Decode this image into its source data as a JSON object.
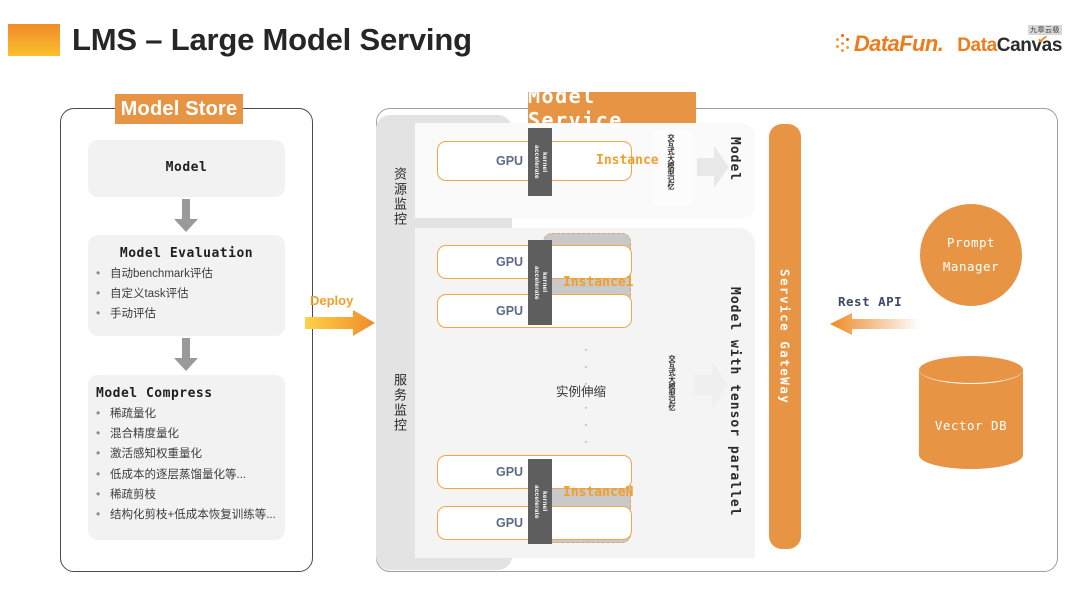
{
  "header": {
    "title": "LMS – Large Model Serving",
    "logos": {
      "datafun": "DataFun.",
      "datacanvas_orange": "Data",
      "datacanvas_dark": "Canvas",
      "datacanvas_cn": "九章云极"
    }
  },
  "colors": {
    "brand_orange": "#E89445",
    "accent_orange": "#F0A02A",
    "gpu_border": "#F0A64B",
    "kernel_dark": "#5E5E5E",
    "panel_gray": "#E3E3E3",
    "card_gray": "#F2F2F2",
    "text_dark": "#262626"
  },
  "model_store": {
    "tag": "Model Store",
    "cards": [
      {
        "title": "Model",
        "centered": true,
        "bullets": []
      },
      {
        "title": "Model Evaluation",
        "centered": true,
        "bullets": [
          "自动benchmark评估",
          "自定义task评估",
          "手动评估"
        ]
      },
      {
        "title": "Model Compress",
        "centered": false,
        "bullets": [
          "稀疏量化",
          "混合精度量化",
          "激活感知权重量化",
          "低成本的逐层蒸馏量化等...",
          "稀疏剪枝",
          "结构化剪枝+低成本恢复训练等..."
        ]
      }
    ]
  },
  "deploy": {
    "label": "Deploy"
  },
  "model_service": {
    "tag": "Model Service",
    "monitors": [
      {
        "label": "资源监控"
      },
      {
        "label": "服务监控"
      }
    ],
    "gpu_label": "GPU",
    "kernel_label_line1": "kernel",
    "kernel_label_line2": "accelerate",
    "instances": [
      {
        "name": "Instance"
      },
      {
        "name": "Instance1"
      },
      {
        "name": "InstanceN"
      }
    ],
    "scaling": {
      "label": "实例伸缩",
      "dots_top": "·\n·\n·",
      "dots_bottom": "·\n·\n·"
    },
    "memory_label": "交互式大模型记忆",
    "model_labels": [
      "Model",
      "Model with tensor parallel"
    ],
    "gateway": "Service GateWay"
  },
  "right_side": {
    "rest_api": "Rest API",
    "prompt_manager_line1": "Prompt",
    "prompt_manager_line2": "Manager",
    "vector_db": "Vector DB"
  }
}
